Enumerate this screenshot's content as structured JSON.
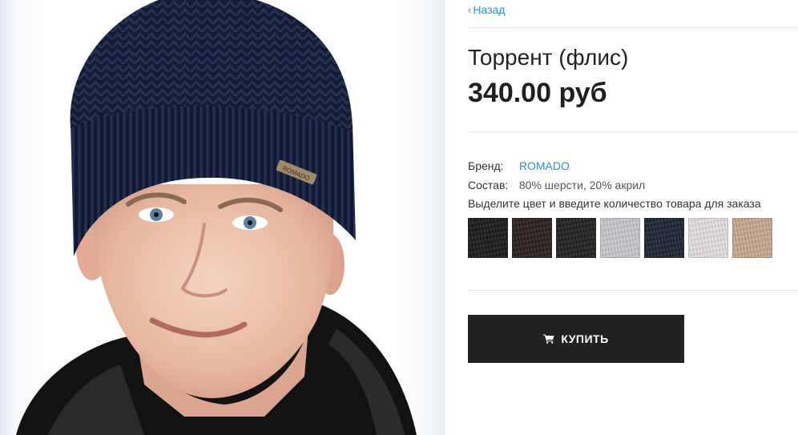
{
  "nav": {
    "back_label": "Назад"
  },
  "product": {
    "title": "Торрент (флис)",
    "price": "340.00 руб",
    "hat_tag": "ROMADO"
  },
  "details": {
    "brand_label": "Бренд:",
    "brand_value": "ROMADO",
    "composition_label": "Состав:",
    "composition_value": "80% шерсти, 20% акрил",
    "hint": "Выделите цвет и введите количество товара для заказа"
  },
  "swatches": [
    {
      "color": "#1c1a19"
    },
    {
      "color": "#2b1f1c"
    },
    {
      "color": "#23211f"
    },
    {
      "color": "#c9cacd"
    },
    {
      "color": "#1a2633"
    },
    {
      "color": "#e6e3e1"
    },
    {
      "color": "#c9ab96"
    }
  ],
  "buy": {
    "label": "КУПИТЬ",
    "icon": "cart-icon"
  }
}
